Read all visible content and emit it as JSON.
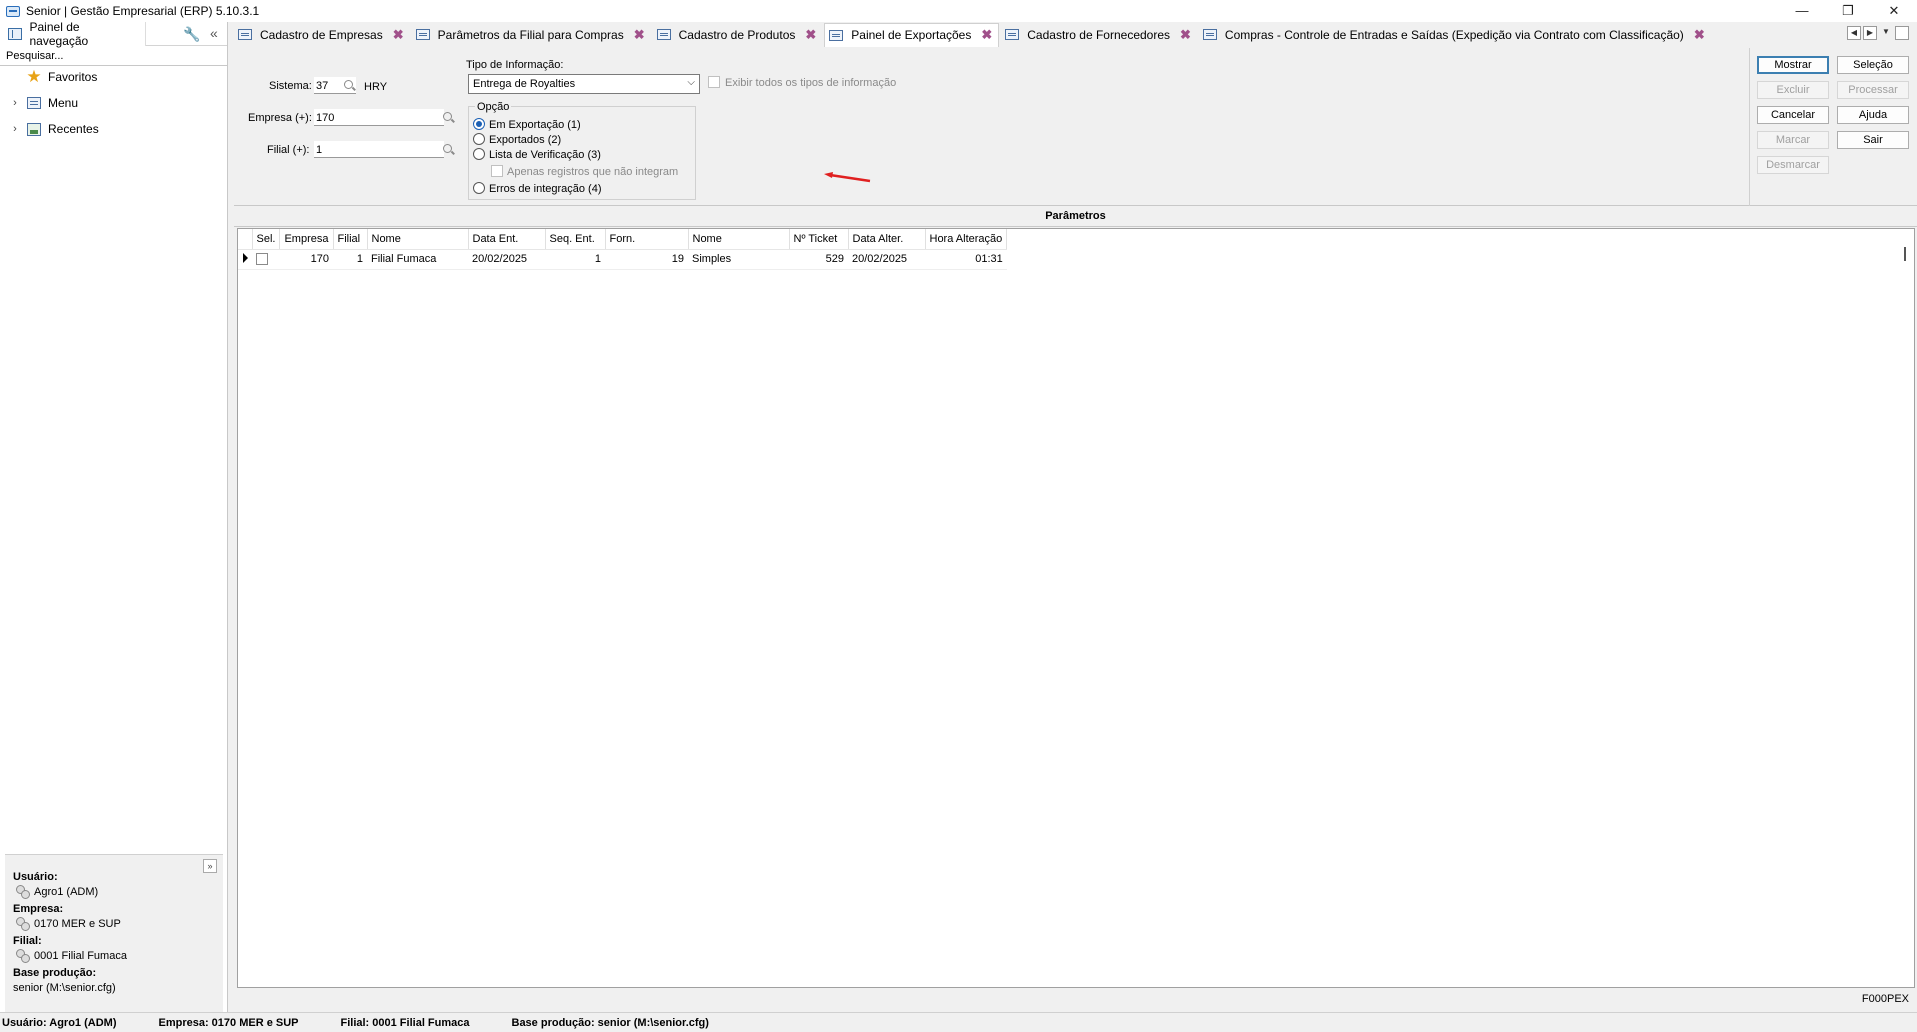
{
  "window": {
    "title": "Senior | Gestão Empresarial (ERP) 5.10.3.1",
    "minimize": "—",
    "restore": "❐",
    "close": "✕"
  },
  "nav": {
    "tab_label": "Painel de navegação",
    "search_placeholder": "Pesquisar...",
    "items": [
      {
        "label": "Favoritos",
        "icon": "star-icon"
      },
      {
        "label": "Menu",
        "icon": "menu-icon"
      },
      {
        "label": "Recentes",
        "icon": "recent-icon"
      }
    ],
    "user_label": "Usuário:",
    "user_value": "Agro1 (ADM)",
    "empresa_label": "Empresa:",
    "empresa_value": "0170 MER e SUP",
    "filial_label": "Filial:",
    "filial_value": "0001 Filial Fumaca",
    "base_label": "Base produção:",
    "base_value": "senior (M:\\senior.cfg)"
  },
  "tabs": [
    {
      "label": "Cadastro de Empresas",
      "active": false
    },
    {
      "label": "Parâmetros da Filial para Compras",
      "active": false
    },
    {
      "label": "Cadastro de Produtos",
      "active": false
    },
    {
      "label": "Painel de Exportações",
      "active": true
    },
    {
      "label": "Cadastro de Fornecedores",
      "active": false
    },
    {
      "label": "Compras - Controle de Entradas e Saídas (Expedição via Contrato com Classificação)",
      "active": false
    }
  ],
  "form": {
    "sistema_label": "Sistema:",
    "sistema_value": "37",
    "sistema_desc": "HRY",
    "empresa_label": "Empresa (+):",
    "empresa_value": "170",
    "filial_label": "Filial (+):",
    "filial_value": "1",
    "tipo_label": "Tipo de Informação:",
    "tipo_value": "Entrega de Royalties",
    "exibir_label": "Exibir todos os tipos de informação",
    "opcao_label": "Opção",
    "options": [
      "Em Exportação (1)",
      "Exportados (2)",
      "Lista de Verificação (3)",
      "Apenas registros que não integram",
      "Erros de integração (4)"
    ],
    "selected_option": "Em Exportação (1)"
  },
  "buttons": {
    "mostrar": "Mostrar",
    "selecao": "Seleção",
    "excluir": "Excluir",
    "processar": "Processar",
    "cancelar": "Cancelar",
    "ajuda": "Ajuda",
    "marcar": "Marcar",
    "sair": "Sair",
    "desmarcar": "Desmarcar"
  },
  "parametros_title": "Parâmetros",
  "grid": {
    "columns": [
      "Sel.",
      "Empresa",
      "Filial",
      "Nome",
      "Data Ent.",
      "Seq. Ent.",
      "Forn.",
      "Nome",
      "Nº Ticket",
      "Data Alter.",
      "Hora Alteração"
    ],
    "rows": [
      {
        "empresa": "170",
        "filial": "1",
        "nome": "Filial Fumaca",
        "data_ent": "20/02/2025",
        "seq_ent": "1",
        "forn": "19",
        "nome_forn": "Simples",
        "ticket": "529",
        "data_alter": "20/02/2025",
        "hora_alter": "01:31"
      }
    ]
  },
  "form_code": "F000PEX",
  "status": {
    "usuario": "Usuário: Agro1 (ADM)",
    "empresa": "Empresa: 0170 MER e SUP",
    "filial": "Filial: 0001 Filial Fumaca",
    "base": "Base produção: senior (M:\\senior.cfg)"
  },
  "colors": {
    "accent": "#1a5fb4",
    "close_tab": "#a0508a",
    "annotation_arrow": "#e02020"
  }
}
